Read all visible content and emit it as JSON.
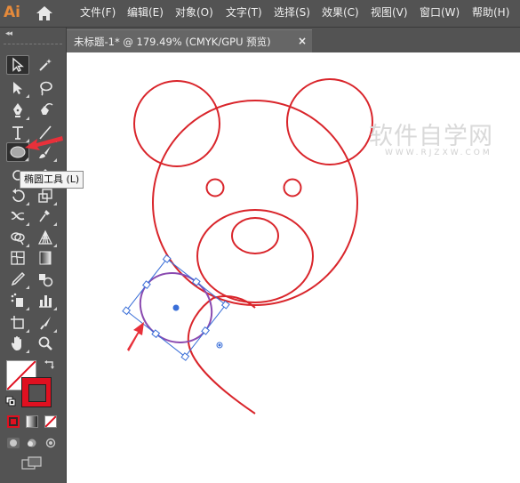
{
  "app": {
    "logo": "Ai"
  },
  "menu": [
    {
      "label": "文件(F)"
    },
    {
      "label": "编辑(E)"
    },
    {
      "label": "对象(O)"
    },
    {
      "label": "文字(T)"
    },
    {
      "label": "选择(S)"
    },
    {
      "label": "效果(C)"
    },
    {
      "label": "视图(V)"
    },
    {
      "label": "窗口(W)"
    },
    {
      "label": "帮助(H)"
    }
  ],
  "document_tab": {
    "title": "未标题-1* @ 179.49% (CMYK/GPU 预览)",
    "close": "×"
  },
  "toolbar": {
    "collapse": "◂◂",
    "active_tool": "ellipse-tool",
    "tooltip": "椭圆工具 (L)",
    "tools": [
      "selection-tool",
      "magic-wand-tool",
      "direct-selection-tool",
      "lasso-tool",
      "pen-tool",
      "curvature-tool",
      "type-tool",
      "line-segment-tool",
      "ellipse-tool",
      "paintbrush-tool",
      "shaper-tool",
      "eraser-tool",
      "rotate-tool",
      "scale-tool",
      "width-tool",
      "puppet-warp-tool",
      "shape-builder-tool",
      "perspective-grid-tool",
      "mesh-tool",
      "gradient-tool",
      "eyedropper-tool",
      "blend-tool",
      "symbol-sprayer-tool",
      "column-graph-tool",
      "artboard-tool",
      "slice-tool",
      "hand-tool",
      "zoom-tool"
    ]
  },
  "colors": {
    "accent_arrow": "#e8303a",
    "stroke_color": "#e01020",
    "fill_color": "none",
    "artwork_stroke": "#d9252b",
    "selection_blue": "#3a6fd8",
    "ellipse_purple": "#8a4ab0",
    "canvas": "#ffffff",
    "ui_background": "#535353"
  },
  "watermark": {
    "main": "软件自学网",
    "sub": "WWW.RJZXW.COM"
  }
}
